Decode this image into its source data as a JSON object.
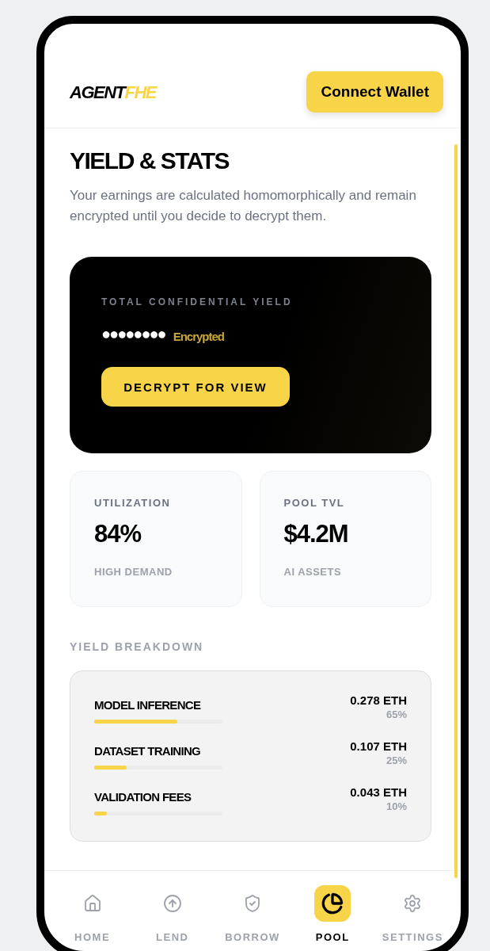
{
  "header": {
    "logo": {
      "primary": "AGENT",
      "accent": "FHE"
    },
    "connect_button": "Connect Wallet"
  },
  "page": {
    "title": "YIELD & STATS",
    "description": "Your earnings are calculated homomorphically and remain encrypted until you decide to decrypt them."
  },
  "yield_card": {
    "label": "TOTAL CONFIDENTIAL YIELD",
    "masked_value": "●●●●●●●●",
    "status": "Encrypted",
    "button": "DECRYPT FOR VIEW"
  },
  "stats": [
    {
      "label": "UTILIZATION",
      "value": "84%",
      "caption": "HIGH DEMAND"
    },
    {
      "label": "POOL TVL",
      "value": "$4.2M",
      "caption": "AI ASSETS"
    }
  ],
  "breakdown": {
    "title": "YIELD BREAKDOWN",
    "rows": [
      {
        "name": "MODEL INFERENCE",
        "amount": "0.278 ETH",
        "share": "65%",
        "level": 0.65
      },
      {
        "name": "DATASET TRAINING",
        "amount": "0.107 ETH",
        "share": "25%",
        "level": 0.25
      },
      {
        "name": "VALIDATION FEES",
        "amount": "0.043 ETH",
        "share": "10%",
        "level": 0.1
      }
    ]
  },
  "nav": [
    {
      "label": "HOME",
      "selected": false
    },
    {
      "label": "LEND",
      "selected": false
    },
    {
      "label": "BORROW",
      "selected": false
    },
    {
      "label": "POOL",
      "selected": true
    },
    {
      "label": "SETTINGS",
      "selected": false
    }
  ]
}
